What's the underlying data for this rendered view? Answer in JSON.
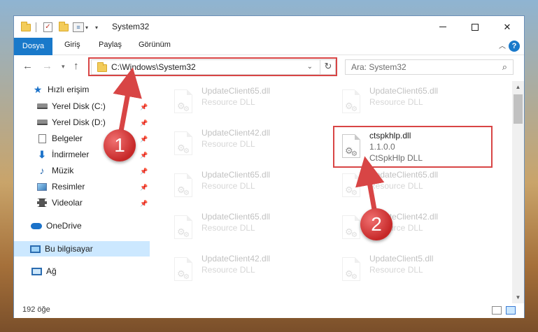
{
  "window": {
    "title": "System32",
    "controls": {
      "minimize": "—",
      "maximize": "☐",
      "close": "✕"
    }
  },
  "ribbon": {
    "tabs": [
      "Dosya",
      "Giriş",
      "Paylaş",
      "Görünüm"
    ],
    "help": "?"
  },
  "address": {
    "path": "C:\\Windows\\System32",
    "search_placeholder": "Ara: System32"
  },
  "sidebar": {
    "quick_access": "Hızlı erişim",
    "items": [
      {
        "label": "Yerel Disk (C:)",
        "icon": "drive-icon",
        "pinned": true
      },
      {
        "label": "Yerel Disk (D:)",
        "icon": "drive-icon",
        "pinned": true
      },
      {
        "label": "Belgeler",
        "icon": "documents-icon",
        "pinned": true
      },
      {
        "label": "İndirmeler",
        "icon": "downloads-icon",
        "pinned": true
      },
      {
        "label": "Müzik",
        "icon": "music-icon",
        "pinned": true
      },
      {
        "label": "Resimler",
        "icon": "pictures-icon",
        "pinned": true
      },
      {
        "label": "Videolar",
        "icon": "videos-icon",
        "pinned": true
      }
    ],
    "onedrive": "OneDrive",
    "this_pc": "Bu bilgisayar",
    "network": "Ağ"
  },
  "files": [
    {
      "name": "UpdateClient65.dll",
      "desc": "Resource DLL",
      "faded": true
    },
    {
      "name": "UpdateClient65.dll",
      "desc": "Resource DLL",
      "faded": true
    },
    {
      "name": "UpdateClient42.dll",
      "desc": "Resource DLL",
      "faded": true
    },
    {
      "name": "ctspkhlp.dll",
      "version": "1.1.0.0",
      "desc": "CtSpkHlp DLL",
      "faded": false
    },
    {
      "name": "UpdateClient65.dll",
      "desc": "Resource DLL",
      "faded": true
    },
    {
      "name": "UpdateClient65.dll",
      "desc": "Resource DLL",
      "faded": true
    },
    {
      "name": "UpdateClient65.dll",
      "desc": "Resource DLL",
      "faded": true
    },
    {
      "name": "UpdateClient42.dll",
      "desc": "Resource DLL",
      "faded": true
    },
    {
      "name": "UpdateClient42.dll",
      "desc": "Resource DLL",
      "faded": true
    },
    {
      "name": "UpdateClient5.dll",
      "desc": "Resource DLL",
      "faded": true
    }
  ],
  "status": {
    "item_count": "192 öğe"
  },
  "callouts": [
    "1",
    "2"
  ],
  "colors": {
    "accent": "#1979ca",
    "highlight": "#d84545",
    "selection": "#cce8ff"
  }
}
